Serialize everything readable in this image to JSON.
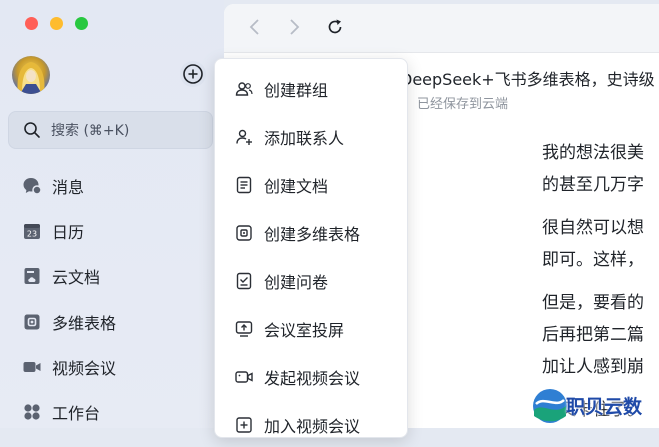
{
  "window": {
    "traffic_lights": [
      "close",
      "minimize",
      "zoom"
    ]
  },
  "sidebar": {
    "search_label": "搜索 (⌘+K)",
    "items": [
      {
        "label": "消息",
        "icon": "chat-bubble-icon"
      },
      {
        "label": "日历",
        "icon": "calendar-icon"
      },
      {
        "label": "云文档",
        "icon": "cloud-doc-icon"
      },
      {
        "label": "多维表格",
        "icon": "base-table-icon"
      },
      {
        "label": "视频会议",
        "icon": "video-camera-icon"
      },
      {
        "label": "工作台",
        "icon": "workspace-grid-icon"
      }
    ],
    "calendar_day": "23"
  },
  "menu": {
    "items": [
      {
        "label": "创建群组",
        "icon": "group-icon"
      },
      {
        "label": "添加联系人",
        "icon": "add-contact-icon"
      },
      {
        "label": "创建文档",
        "icon": "document-icon"
      },
      {
        "label": "创建多维表格",
        "icon": "base-table-icon"
      },
      {
        "label": "创建问卷",
        "icon": "survey-icon"
      },
      {
        "label": "会议室投屏",
        "icon": "screen-share-icon"
      },
      {
        "label": "发起视频会议",
        "icon": "video-camera-icon"
      },
      {
        "label": "加入视频会议",
        "icon": "join-meeting-icon"
      }
    ]
  },
  "document": {
    "title": "DeepSeek+飞书多维表格，史诗级",
    "status": "已经保存到云端",
    "lines": [
      "我的想法很美",
      "的甚至几万字",
      "很自然可以想",
      "即可。这样，",
      "但是，要看的",
      "后再把第二篇",
      "加让人感到崩",
      "我又卡住了。"
    ]
  },
  "watermark": {
    "text": "职贝云数"
  }
}
